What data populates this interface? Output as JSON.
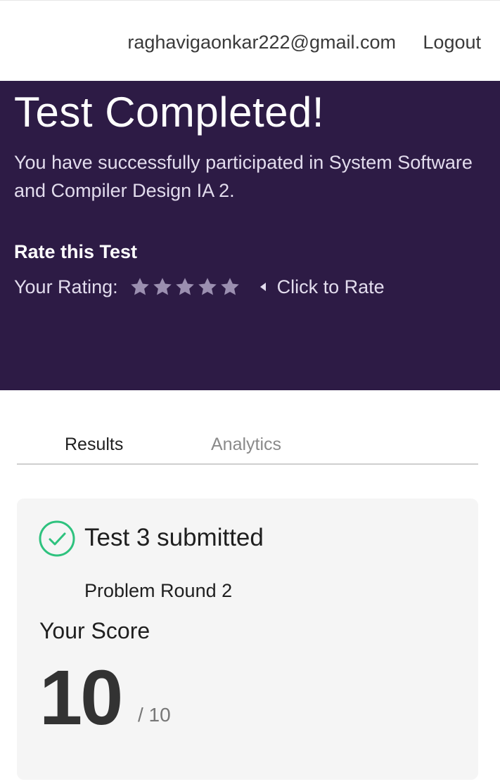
{
  "header": {
    "email": "raghavigaonkar222@gmail.com",
    "logout_label": "Logout"
  },
  "hero": {
    "title": "Test Completed!",
    "description": "You have successfully participated in System Software and Compiler Design IA 2.",
    "rate_heading": "Rate this Test",
    "rating_label": "Your Rating:",
    "rating_value": 0,
    "rating_max": 5,
    "click_to_rate": "Click to Rate",
    "star_color": "#9b8fb0",
    "background_color": "#2d1b45"
  },
  "tabs": [
    {
      "label": "Results",
      "active": true
    },
    {
      "label": "Analytics",
      "active": false
    }
  ],
  "result": {
    "status_icon": "check-circle-icon",
    "status_color": "#2ec27e",
    "submitted_text": "Test 3 submitted",
    "round_name": "Problem Round 2",
    "score_label": "Your Score",
    "score": "10",
    "total": "/ 10"
  }
}
